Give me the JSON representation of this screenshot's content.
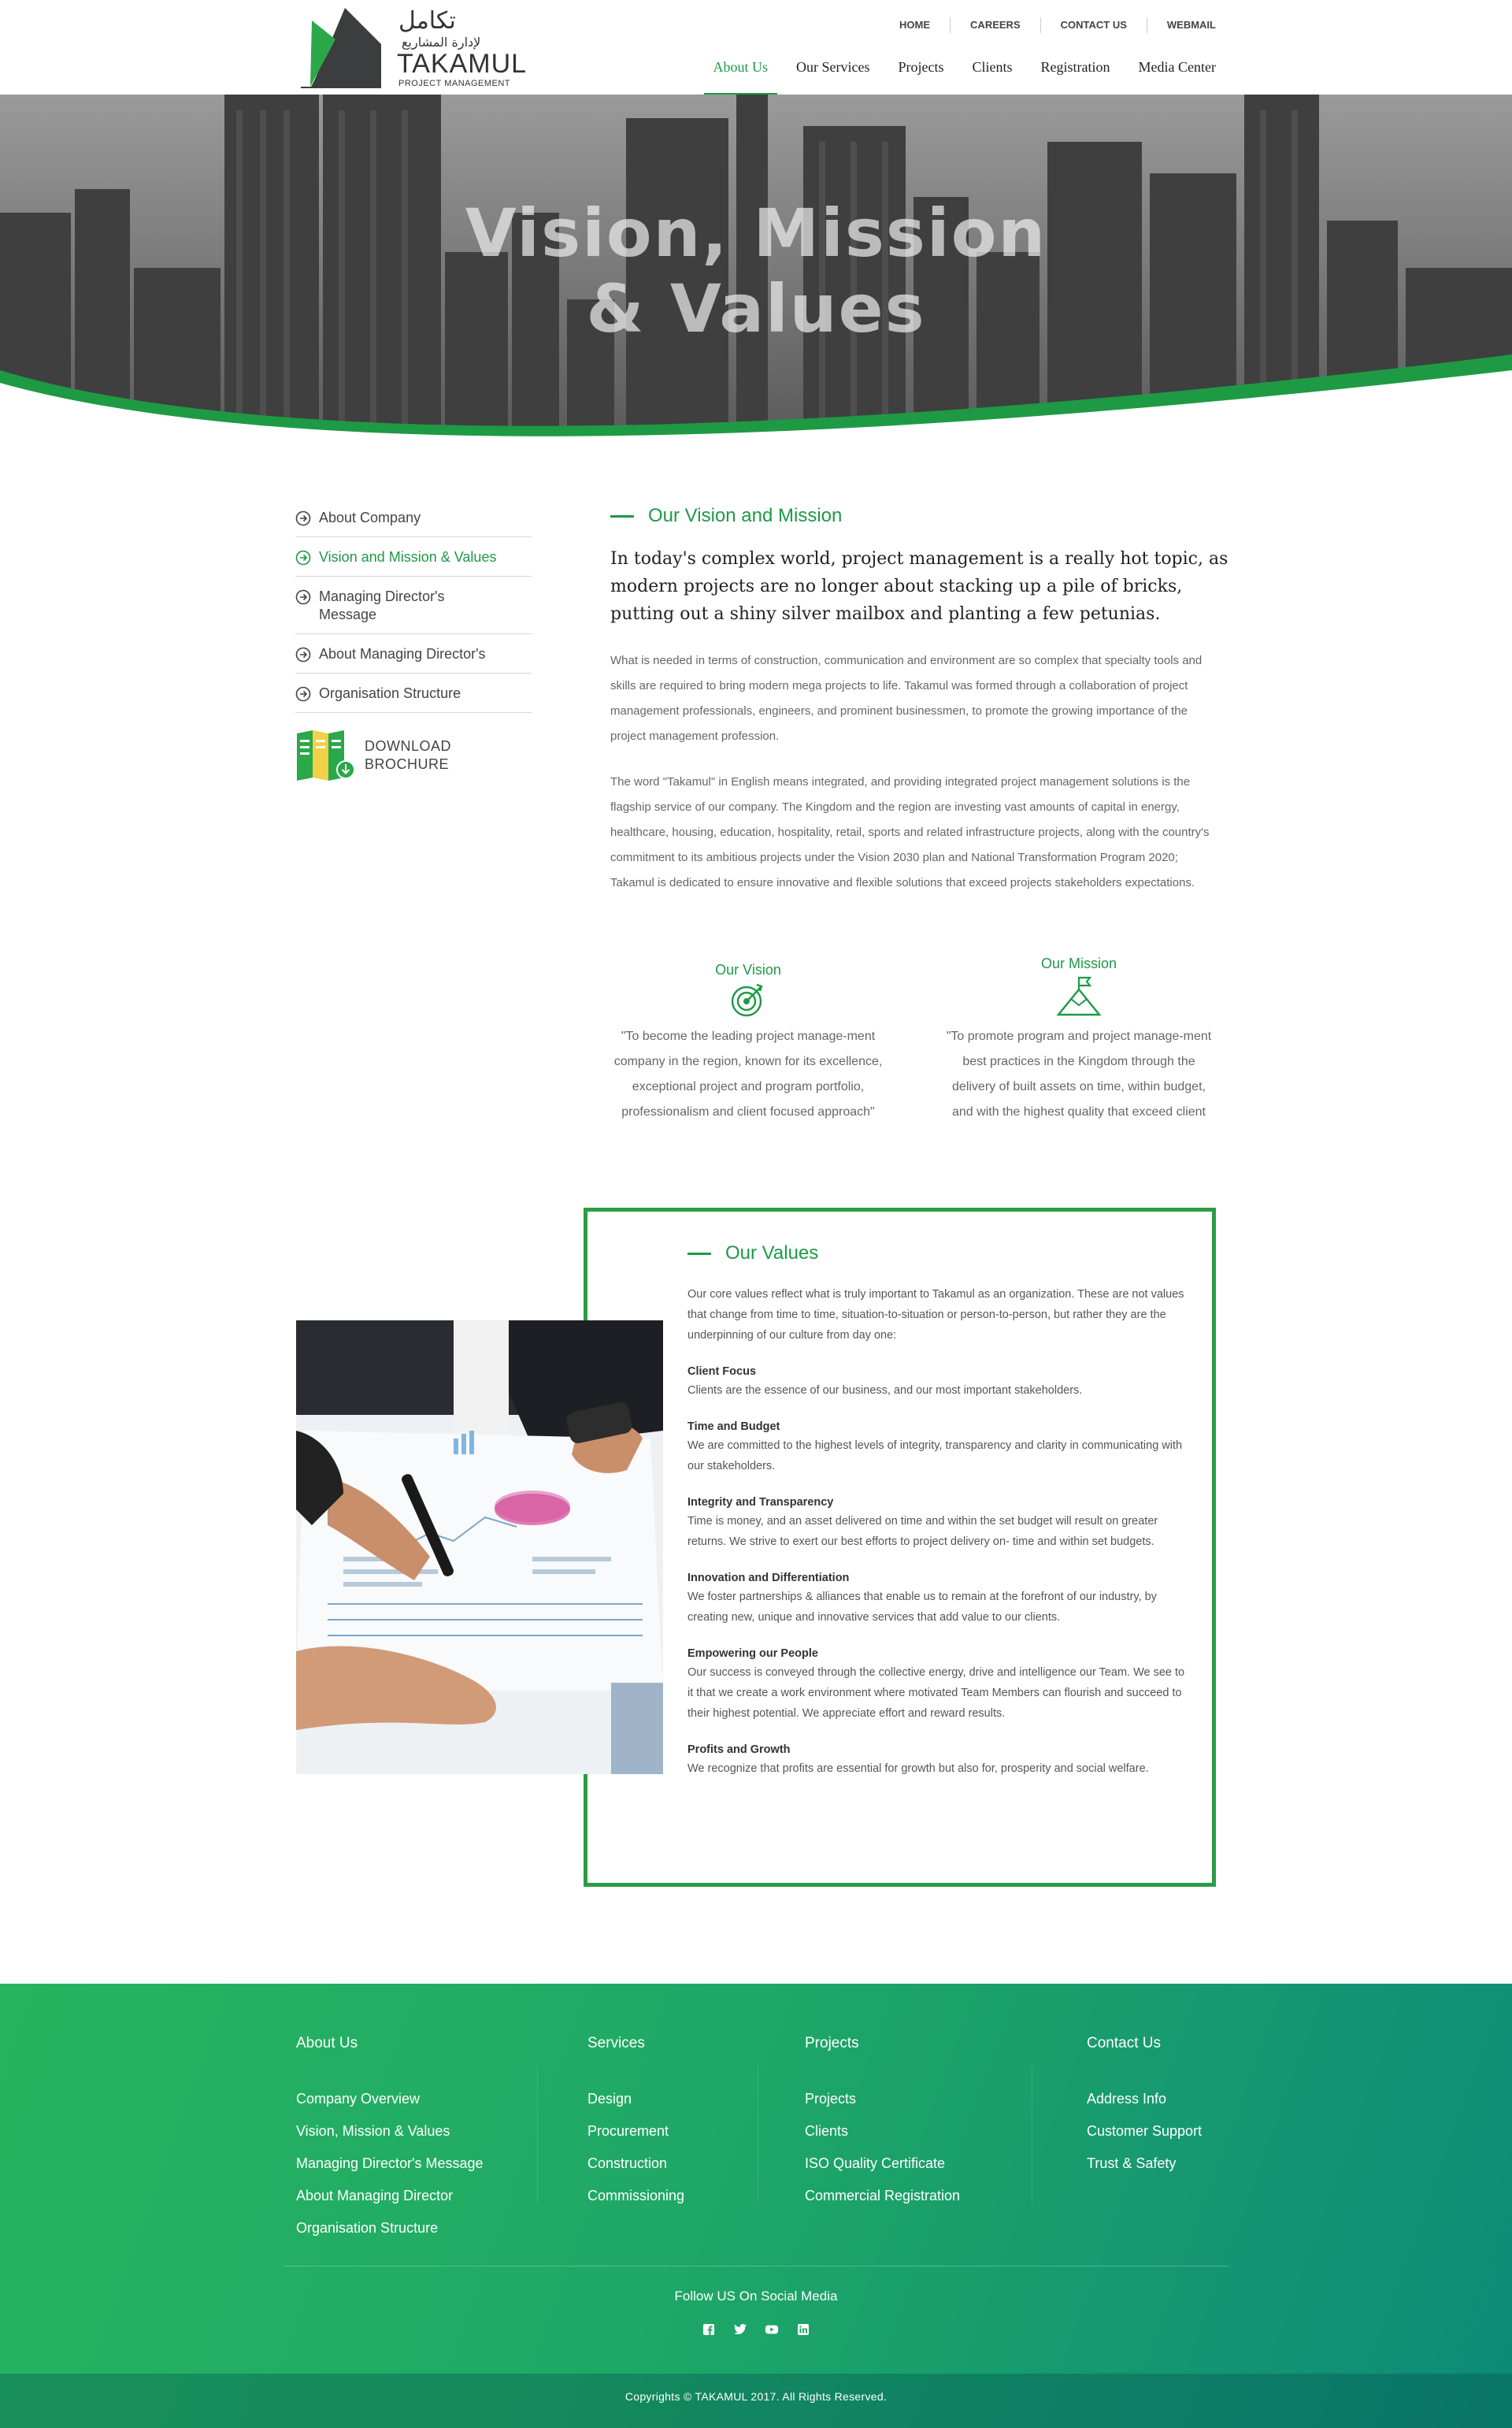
{
  "header": {
    "logo": {
      "arabic": "تكامل",
      "arabic_sub": "لإدارة المشاريع",
      "name": "TAKAMUL",
      "sub": "PROJECT MANAGEMENT"
    },
    "topnav": [
      "HOME",
      "CAREERS",
      "CONTACT US",
      "WEBMAIL"
    ],
    "mainnav": [
      "About Us",
      "Our Services",
      "Projects",
      "Clients",
      "Registration",
      "Media Center"
    ],
    "active_nav": "About Us"
  },
  "hero": {
    "title_line1": "Vision, Mission",
    "title_line2": "& Values"
  },
  "sidebar": {
    "items": [
      {
        "label": "About Company",
        "active": false
      },
      {
        "label": "Vision and Mission & Values",
        "active": true
      },
      {
        "label": "Managing Director's Message",
        "active": false
      },
      {
        "label": "About Managing Director's",
        "active": false
      },
      {
        "label": "Organisation Structure",
        "active": false
      }
    ],
    "brochure_line1": "DOWNLOAD",
    "brochure_line2": "BROCHURE"
  },
  "main": {
    "title": "Our Vision and Mission",
    "lead": "In today's complex world, project management is a really hot topic, as modern projects are no longer about stacking up a pile of bricks, putting out a shiny silver mailbox and planting a few petunias.",
    "para1": "What is needed in terms of construction, communication and environment are so complex that specialty tools and skills are required to bring modern mega projects to life. Takamul was formed through a collaboration of project management professionals, engineers, and prominent businessmen, to promote the growing importance of the project management profession.",
    "para2": "The word \"Takamul\" in English means integrated, and providing integrated project management solutions is the flagship service of our company. The Kingdom and the region are investing vast amounts of capital in energy, healthcare, housing, education, hospitality, retail, sports and related infrastructure projects, along with the country's commitment to its ambitious projects under the Vision 2030 plan and National Transformation Program 2020; Takamul is dedicated to ensure innovative and flexible solutions that exceed projects stakeholders expectations.",
    "vision": {
      "title": "Our Vision",
      "text": "\"To become the leading project manage-ment company in the region, known for its excellence, exceptional project and program portfolio, professionalism and client focused approach\""
    },
    "mission": {
      "title": "Our Mission",
      "text": "\"To promote program and project manage-ment best practices in the Kingdom through the delivery of built assets on time, within budget, and with the highest quality that exceed client"
    }
  },
  "values": {
    "title": "Our Values",
    "intro": "Our core values reflect what is truly important to Takamul as an organization. These are not values that change from time to time, situation-to-situation or person-to-person, but rather they are the underpinning of our culture from day one:",
    "items": [
      {
        "head": "Client Focus",
        "text": "Clients are the essence of our business, and our most important stakeholders."
      },
      {
        "head": "Time and Budget",
        "text": "We are committed to the highest levels of integrity, transparency and clarity in communicating with our stakeholders."
      },
      {
        "head": "Integrity and Transparency",
        "text": "Time is money, and an asset delivered on time and within the set budget will result on greater returns. We strive to exert our best efforts to project delivery on- time and within set budgets."
      },
      {
        "head": "Innovation and Differentiation",
        "text": "We foster partnerships & alliances that enable us to remain at the forefront of our industry, by creating new, unique and innovative services that add value to our clients."
      },
      {
        "head": "Empowering our People",
        "text": "Our success is conveyed through the collective energy, drive and intelligence our Team. We see to it that we create a work environment where motivated Team Members can flourish and succeed to their highest potential. We appreciate effort and reward results."
      },
      {
        "head": "Profits and Growth",
        "text": "We recognize that profits are essential for growth but also for, prosperity and social welfare."
      }
    ]
  },
  "footer": {
    "about": {
      "head": "About Us",
      "links": [
        "Company Overview",
        "Vision, Mission & Values",
        "Managing Director's Message",
        "About Managing Director",
        "Organisation Structure"
      ]
    },
    "services": {
      "head": "Services",
      "links": [
        "Design",
        "Procurement",
        "Construction",
        "Commissioning"
      ]
    },
    "projects": {
      "head": "Projects",
      "links": [
        "Projects",
        "Clients",
        "ISO Quality Certificate",
        "Commercial Registration"
      ]
    },
    "contact": {
      "head": "Contact Us",
      "links": [
        "Address Info",
        "Customer Support",
        "Trust & Safety"
      ]
    },
    "follow": "Follow US On Social Media",
    "social_icons": [
      "facebook-icon",
      "twitter-icon",
      "youtube-icon",
      "linkedin-icon"
    ],
    "copyright": "Copyrights © TAKAMUL 2017. All Rights Reserved."
  },
  "colors": {
    "accent": "#1d9a47",
    "footer_start": "#27b460",
    "footer_end": "#0e8a78"
  }
}
